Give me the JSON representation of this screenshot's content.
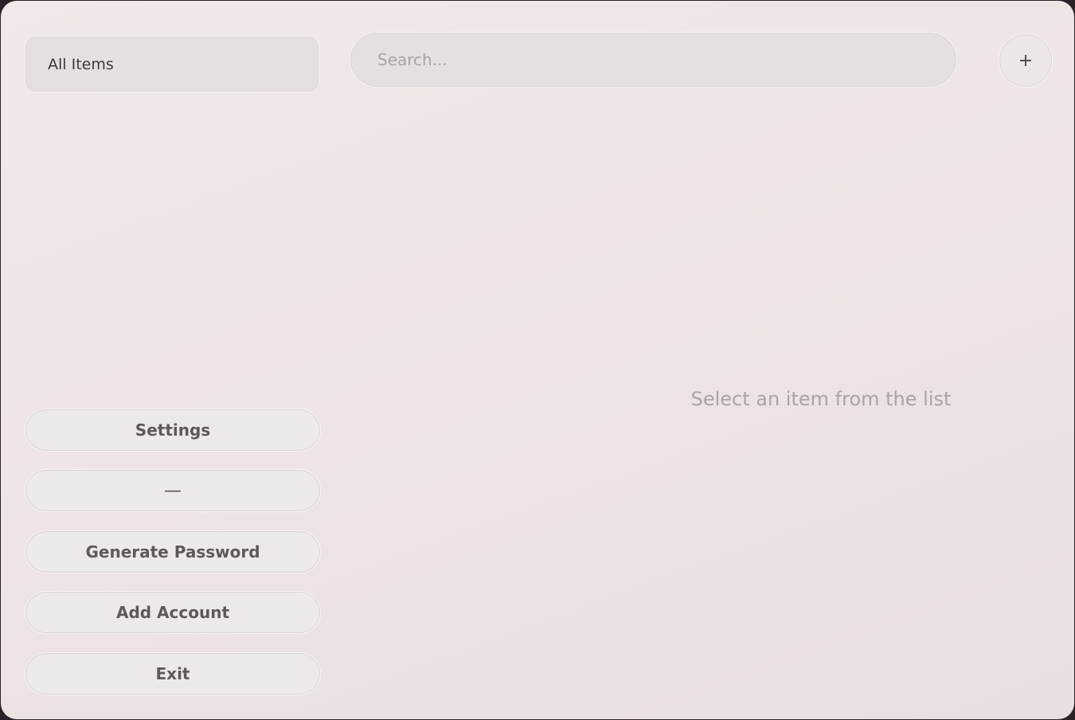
{
  "sidebar": {
    "top_item_label": "All Items",
    "buttons": {
      "settings": "Settings",
      "minimize": "—",
      "generate_password": "Generate Password",
      "add_account": "Add Account",
      "exit": "Exit"
    }
  },
  "search": {
    "placeholder": "Search...",
    "value": ""
  },
  "header": {
    "add_label": "+"
  },
  "main": {
    "empty_message": "Select an item from the list"
  }
}
